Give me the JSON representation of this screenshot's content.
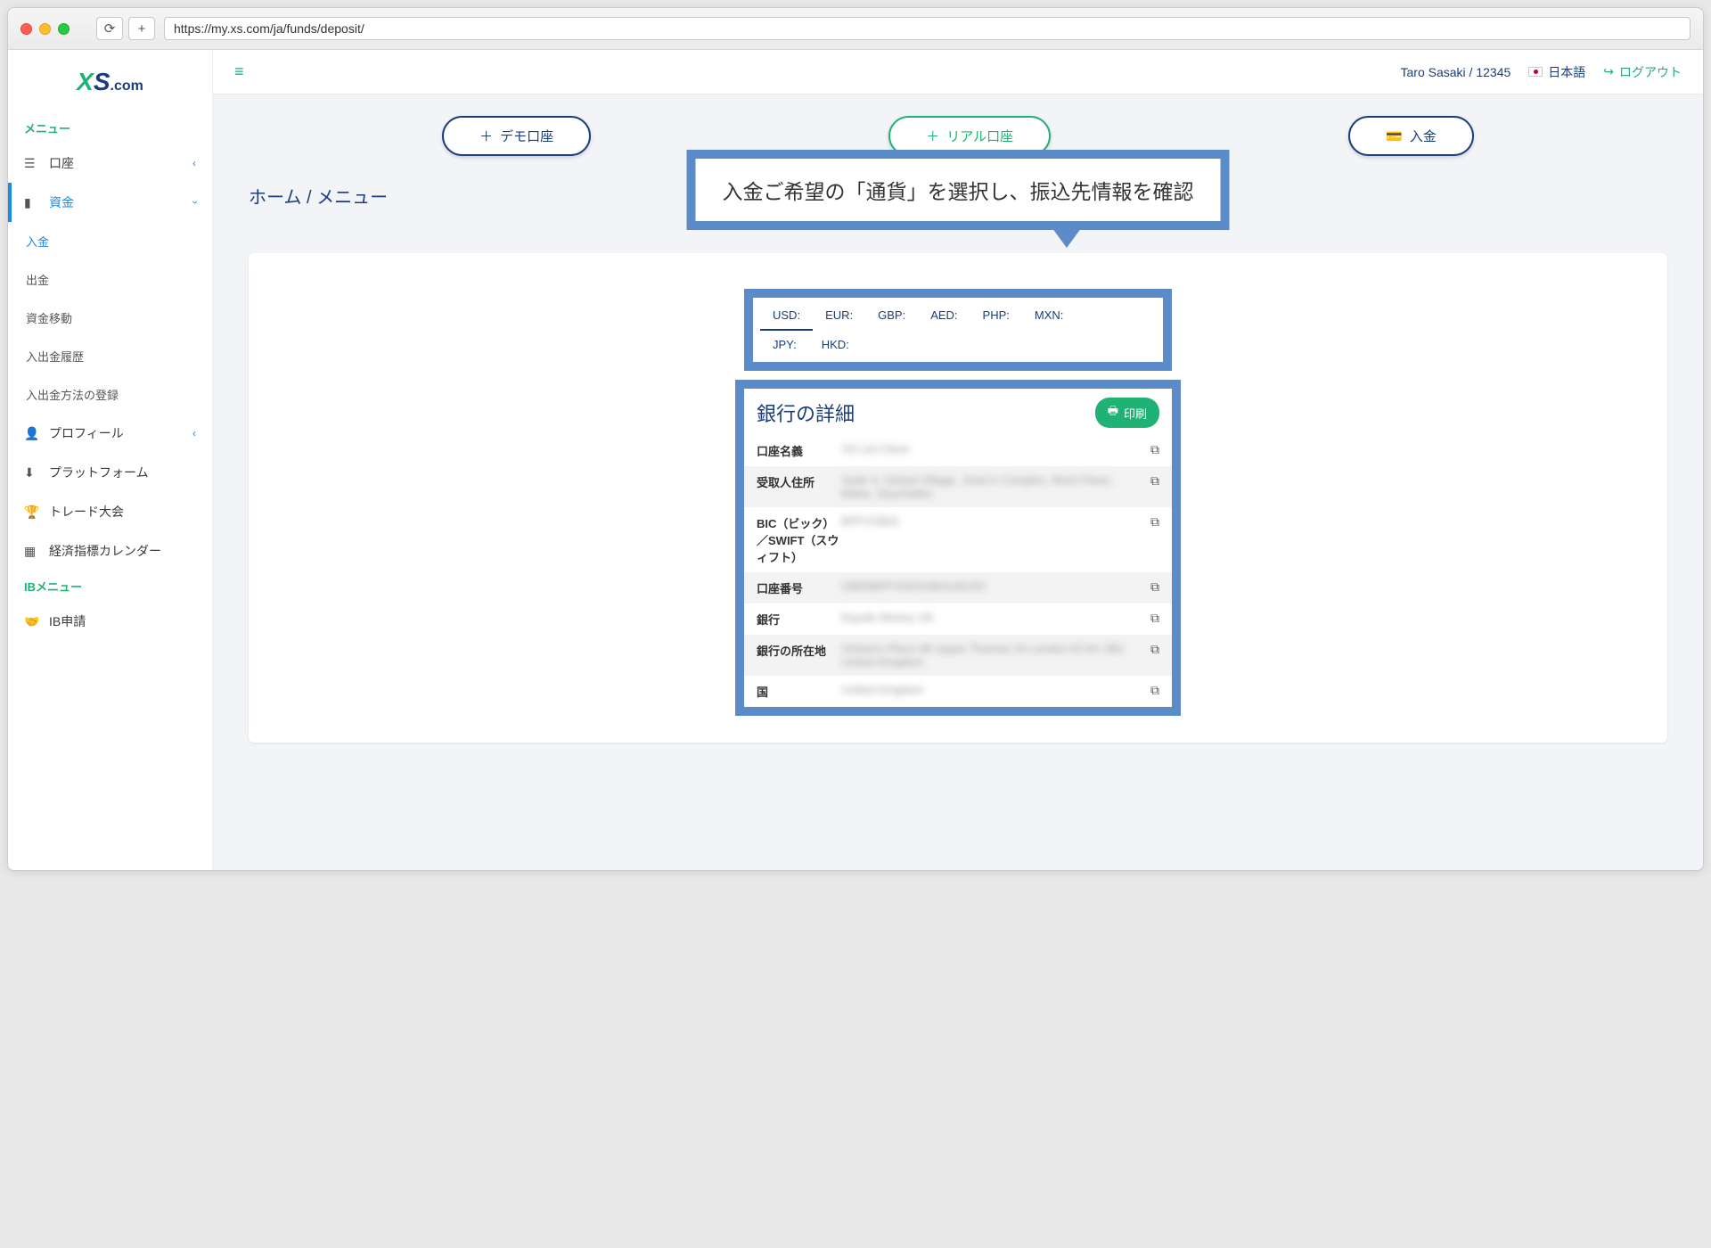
{
  "browser": {
    "url": "https://my.xs.com/ja/funds/deposit/"
  },
  "logo": {
    "x": "XS",
    "com": ".com"
  },
  "sidebar": {
    "menu_header": "メニュー",
    "account": "口座",
    "funds": "資金",
    "deposit": "入金",
    "withdraw": "出金",
    "transfer": "資金移動",
    "history": "入出金履歴",
    "register_method": "入出金方法の登録",
    "profile": "プロフィール",
    "platform": "プラットフォーム",
    "contest": "トレード大会",
    "calendar": "経済指標カレンダー",
    "ib_header": "IBメニュー",
    "ib_apply": "IB申請"
  },
  "topbar": {
    "user": "Taro Sasaki / 12345",
    "language": "日本語",
    "logout": "ログアウト"
  },
  "actions": {
    "demo": "デモ口座",
    "real": "リアル口座",
    "deposit": "入金"
  },
  "breadcrumb": "ホーム / メニュー",
  "annotation": "入金ご希望の「通貨」を選択し、振込先情報を確認",
  "currencies": [
    "USD:",
    "EUR:",
    "GBP:",
    "AED:",
    "PHP:",
    "MXN:",
    "JPY:",
    "HKD:"
  ],
  "details": {
    "title": "銀行の詳細",
    "print": "印刷",
    "rows": [
      {
        "label": "口座名義",
        "value": "XS Ltd Client"
      },
      {
        "label": "受取人住所",
        "value": "Suite 3, Global Village, Jivan's Complex, Mont Fleuri, Mahe, Seychelles"
      },
      {
        "label": "BIC（ビック）／SWIFT（スウィフト）",
        "value": "BPFVGB2L"
      },
      {
        "label": "口座番号",
        "value": "GB00BPFV0201984146150"
      },
      {
        "label": "銀行",
        "value": "Equals Money UK"
      },
      {
        "label": "銀行の所在地",
        "value": "Vintners Place 68 Upper Thames St London EC4V 3BJ United Kingdom"
      },
      {
        "label": "国",
        "value": "United Kingdom"
      }
    ]
  }
}
